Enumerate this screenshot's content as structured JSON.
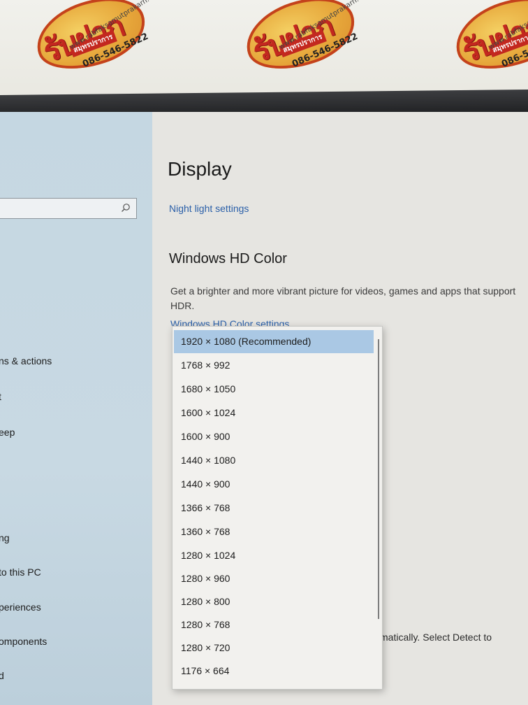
{
  "watermark": {
    "brand": "รับฝาก",
    "sub": "สมุทรปราการ",
    "url": "www.rabfaksamutprakarn.com",
    "phone": "086-546-5822",
    "colors": {
      "red": "#c3281f",
      "gold": "#e6a63a"
    }
  },
  "sidebar": {
    "search_placeholder": "",
    "items": [
      {
        "label": "ns & actions"
      },
      {
        "label": "t"
      },
      {
        "label": "eep"
      },
      {
        "label": "ng"
      },
      {
        "label": " to this PC"
      },
      {
        "label": "periences"
      },
      {
        "label": "omponents"
      },
      {
        "label": "d"
      }
    ]
  },
  "main": {
    "title": "Display",
    "night_light_link": "Night light settings",
    "hd_color": {
      "title": "Windows HD Color",
      "description": "Get a brighter and more vibrant picture for videos, games and apps that support HDR.",
      "settings_link": "Windows HD Color settings"
    },
    "partial_text": "matically. Select Detect to",
    "partial_mark": ";"
  },
  "resolution_dropdown": {
    "selected": "1920 × 1080 (Recommended)",
    "options": [
      "1920 × 1080 (Recommended)",
      "1768 × 992",
      "1680 × 1050",
      "1600 × 1024",
      "1600 × 900",
      "1440 × 1080",
      "1440 × 900",
      "1366 × 768",
      "1360 × 768",
      "1280 × 1024",
      "1280 × 960",
      "1280 × 800",
      "1280 × 768",
      "1280 × 720",
      "1176 × 664"
    ]
  },
  "colors": {
    "accent_link": "#2a5fa8",
    "selected_option": "#aac8e4",
    "sidebar_bg": "#c5d7e2"
  }
}
